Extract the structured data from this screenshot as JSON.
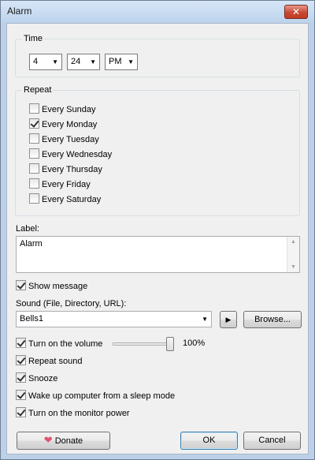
{
  "window": {
    "title": "Alarm",
    "close_glyph": "✕"
  },
  "time": {
    "group_label": "Time",
    "hour": "4",
    "minute": "24",
    "ampm": "PM"
  },
  "repeat": {
    "group_label": "Repeat",
    "days": [
      {
        "label": "Every Sunday",
        "checked": false
      },
      {
        "label": "Every Monday",
        "checked": true
      },
      {
        "label": "Every Tuesday",
        "checked": false
      },
      {
        "label": "Every Wednesday",
        "checked": false
      },
      {
        "label": "Every Thursday",
        "checked": false
      },
      {
        "label": "Every Friday",
        "checked": false
      },
      {
        "label": "Every Saturday",
        "checked": false
      }
    ]
  },
  "label_field": {
    "caption": "Label:",
    "value": "Alarm"
  },
  "show_message": {
    "label": "Show message",
    "checked": true
  },
  "sound": {
    "caption": "Sound (File, Directory, URL):",
    "value": "Bells1",
    "play_glyph": "▶",
    "browse_label": "Browse..."
  },
  "volume": {
    "label": "Turn on the volume",
    "checked": true,
    "level_percent": 100,
    "level_text": "100%"
  },
  "options": [
    {
      "label": "Repeat sound",
      "checked": true
    },
    {
      "label": "Snooze",
      "checked": true
    },
    {
      "label": "Wake up computer from a sleep mode",
      "checked": true
    },
    {
      "label": "Turn on the monitor power",
      "checked": true
    }
  ],
  "buttons": {
    "donate": "Donate",
    "ok": "OK",
    "cancel": "Cancel"
  },
  "icons": {
    "donate": "heart-icon",
    "dropdown": "chevron-down-icon",
    "play": "play-icon",
    "close": "close-icon"
  },
  "colors": {
    "title_bar": "#bcd1e9",
    "close_button": "#c74a33",
    "dialog_bg": "#f0f0f0"
  }
}
